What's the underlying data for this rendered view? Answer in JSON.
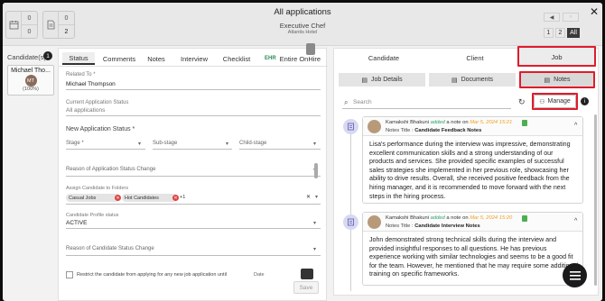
{
  "header": {
    "title": "All applications",
    "job_title": "Executive Chef",
    "location": "Atlantis Hotel",
    "counters": [
      {
        "icon": "calendar-icon",
        "top": "0",
        "bottom": "0"
      },
      {
        "icon": "document-icon",
        "top": "0",
        "bottom": "2"
      }
    ],
    "pages": [
      "1",
      "2",
      "All"
    ],
    "active_page": "All"
  },
  "candidates": {
    "label": "Candidate(s)",
    "count": "1",
    "items": [
      {
        "name": "Michael Tho...",
        "initials": "MT",
        "percent": "(100%)"
      }
    ]
  },
  "left_tabs": [
    "Status",
    "Comments",
    "Notes",
    "Interview",
    "Checklist",
    "Entire OnHire"
  ],
  "status_form": {
    "related_to_label": "Related To *",
    "related_to_value": "Michael Thompson",
    "current_status_label": "Current Application Status",
    "current_status_value": "All applications",
    "new_status_label": "New Application Status *",
    "stage_placeholder": "Stage *",
    "substage_placeholder": "Sub-stage",
    "childstage_placeholder": "Child-stage",
    "reason_change_placeholder": "Reason of Application Status Change",
    "assign_folders_label": "Assign Candidate to Folders",
    "folders": [
      "Casual Jobs",
      "Hot Candidates"
    ],
    "folders_more": "+1",
    "profile_status_label": "Candidate Profile status",
    "profile_status_value": "ACTIVE",
    "reason_candidate_placeholder": "Reason of Candidate Status Change",
    "restrict_text": "Restrict the candidate from applying for any new job application until",
    "date_placeholder": "Date",
    "save_label": "Save"
  },
  "right_tabs": [
    "Candidate",
    "Client",
    "Job"
  ],
  "right_subtabs": [
    "Job Details",
    "Documents",
    "Notes"
  ],
  "search_placeholder": "Search",
  "manage_label": "Manage",
  "notes": [
    {
      "author": "Kamakshi Bhakuni",
      "action": "added",
      "mid": "a note on",
      "date": "Mar 5, 2024 15:21",
      "title_label": "Notes Title :",
      "title": "Candidate Feedback Notes",
      "body": "Lisa's performance during the interview was impressive, demonstrating excellent communication skills and a strong understanding of our products and services. She provided specific examples of successful sales strategies she implemented in her previous role, showcasing her ability to drive results. Overall, she received positive feedback from the hiring manager, and it is recommended to move forward with the next steps in the hiring process."
    },
    {
      "author": "Kamakshi Bhakuni",
      "action": "added",
      "mid": "a note on",
      "date": "Mar 5, 2024 15:20",
      "title_label": "Notes Title :",
      "title": "Candidate Interview Notes",
      "body": "John demonstrated strong technical skills during the interview and provided insightful responses to all questions. He has previous experience working with similar technologies and seems to be a good fit for the team. However, he mentioned that he may require some additional training on specific frameworks."
    }
  ],
  "colors": {
    "highlight": "#e01b2a",
    "accent_date": "#f0a020",
    "chip_remove": "#e04343"
  }
}
